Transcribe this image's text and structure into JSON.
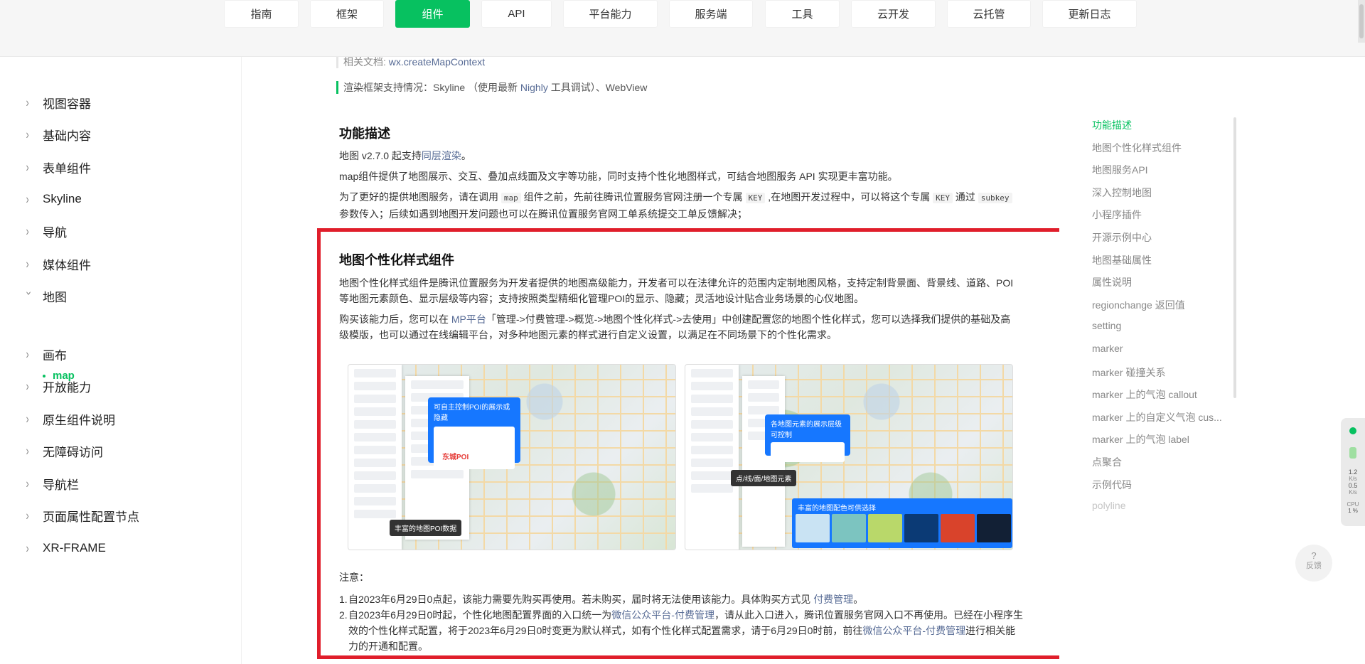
{
  "topnav": {
    "items": [
      {
        "label": "指南"
      },
      {
        "label": "框架"
      },
      {
        "label": "组件",
        "active": true
      },
      {
        "label": "API"
      },
      {
        "label": "平台能力"
      },
      {
        "label": "服务端"
      },
      {
        "label": "工具"
      },
      {
        "label": "云开发"
      },
      {
        "label": "云托管"
      },
      {
        "label": "更新日志"
      }
    ]
  },
  "sidebar": {
    "items": [
      {
        "label": "视图容器"
      },
      {
        "label": "基础内容"
      },
      {
        "label": "表单组件"
      },
      {
        "label": "Skyline"
      },
      {
        "label": "导航"
      },
      {
        "label": "媒体组件"
      },
      {
        "label": "地图",
        "expanded": true
      },
      {
        "label": "画布"
      },
      {
        "label": "开放能力"
      },
      {
        "label": "原生组件说明"
      },
      {
        "label": "无障碍访问"
      },
      {
        "label": "导航栏"
      },
      {
        "label": "页面属性配置节点"
      },
      {
        "label": "XR-FRAME"
      }
    ],
    "sub_item": "map"
  },
  "content": {
    "related_prefix": "相关文档: ",
    "related_link": "wx.createMapContext",
    "render_prefix": "渲染框架支持情况：Skyline （使用最新 ",
    "render_link": "Nighly",
    "render_suffix": " 工具调试）、WebView",
    "section1_title": "功能描述",
    "p1_prefix": "地图 v2.7.0 起支持",
    "p1_link": "同层渲染",
    "p1_suffix": "。",
    "p2": "map组件提供了地图展示、交互、叠加点线面及文字等功能，同时支持个性化地图样式，可结合地图服务 API 实现更丰富功能。",
    "p3_a": "为了更好的提供地图服务，请在调用 ",
    "p3_code1": "map",
    "p3_b": " 组件之前，先前往腾讯位置服务官网注册一个专属 ",
    "p3_code2": "KEY",
    "p3_c": " ,在地图开发过程中，可以将这个专属 ",
    "p3_code3": "KEY",
    "p3_d": " 通过 ",
    "p3_code4": "subkey",
    "p3_e": "参数传入；后续如遇到地图开发问题也可以在腾讯位置服务官网工单系统提交工单反馈解决；",
    "section2_title": "地图个性化样式组件",
    "p4": "地图个性化样式组件是腾讯位置服务为开发者提供的地图高级能力，开发者可以在法律允许的范围内定制地图风格，支持定制背景面、背景线、道路、POI等地图元素颜色、显示层级等内容；支持按照类型精细化管理POI的显示、隐藏；灵活地设计贴合业务场景的心仪地图。",
    "p5_a": "购买该能力后，您可以在 ",
    "p5_link": "MP平台",
    "p5_b": "「管理->付费管理->概览->地图个性化样式->去使用」中创建配置您的地图个性化样式，您可以选择我们提供的基础及高级模版，也可以通过在线编辑平台，对多种地图元素的样式进行自定义设置，以满足在不同场景下的个性化需求。",
    "img1": {
      "callout": "可自主控制POI的展示或隐藏",
      "poi": "东城POI",
      "tag": "丰富的地图POI数据"
    },
    "img2": {
      "callout": "各地图元素的展示层级可控制",
      "tag": "点/线/面/地图元素",
      "tiles_label": "丰富的地图配色可供选择"
    },
    "note_label": "注意：",
    "notes": [
      {
        "num": "1.",
        "text_a": "自2023年6月29日0点起，该能力需要先购买再使用。若未购买，届时将无法使用该能力。具体购买方式见 ",
        "link": "付费管理",
        "text_b": "。"
      },
      {
        "num": "2.",
        "text_a": "自2023年6月29日0时起，个性化地图配置界面的入口统一为",
        "link": "微信公众平台-付费管理",
        "text_b": "，请从此入口进入，腾讯位置服务官网入口不再使用。已经在小程序生效的个性化样式配置，将于2023年6月29日0时变更为默认样式，如有个性化样式配置需求，请于6月29日0时前，前往",
        "link2": "微信公众平台-付费管理",
        "text_c": "进行相关能力的开通和配置。"
      }
    ]
  },
  "toc": {
    "items": [
      {
        "label": "功能描述",
        "state": "active"
      },
      {
        "label": "地图个性化样式组件"
      },
      {
        "label": "地图服务API"
      },
      {
        "label": "深入控制地图"
      },
      {
        "label": "小程序插件"
      },
      {
        "label": "开源示例中心"
      },
      {
        "label": "地图基础属性"
      },
      {
        "label": "属性说明"
      },
      {
        "label": "regionchange 返回值"
      },
      {
        "label": "setting"
      },
      {
        "label": "marker"
      },
      {
        "label": "marker 碰撞关系"
      },
      {
        "label": "marker 上的气泡 callout"
      },
      {
        "label": "marker 上的自定义气泡 cus..."
      },
      {
        "label": "marker 上的气泡 label"
      },
      {
        "label": "点聚合"
      },
      {
        "label": "示例代码"
      },
      {
        "label": "polyline",
        "state": "faint"
      }
    ]
  },
  "widget": {
    "v1": "1.2",
    "u1": "K/s",
    "v2": "0.5",
    "u2": "K/s",
    "cpu": "CPU",
    "cpu_val": "1 %"
  },
  "feedback": {
    "icon": "?",
    "label": "反馈"
  },
  "colors": {
    "accent": "#07c160",
    "link": "#576b95",
    "highlight_border": "#e01e2b"
  }
}
